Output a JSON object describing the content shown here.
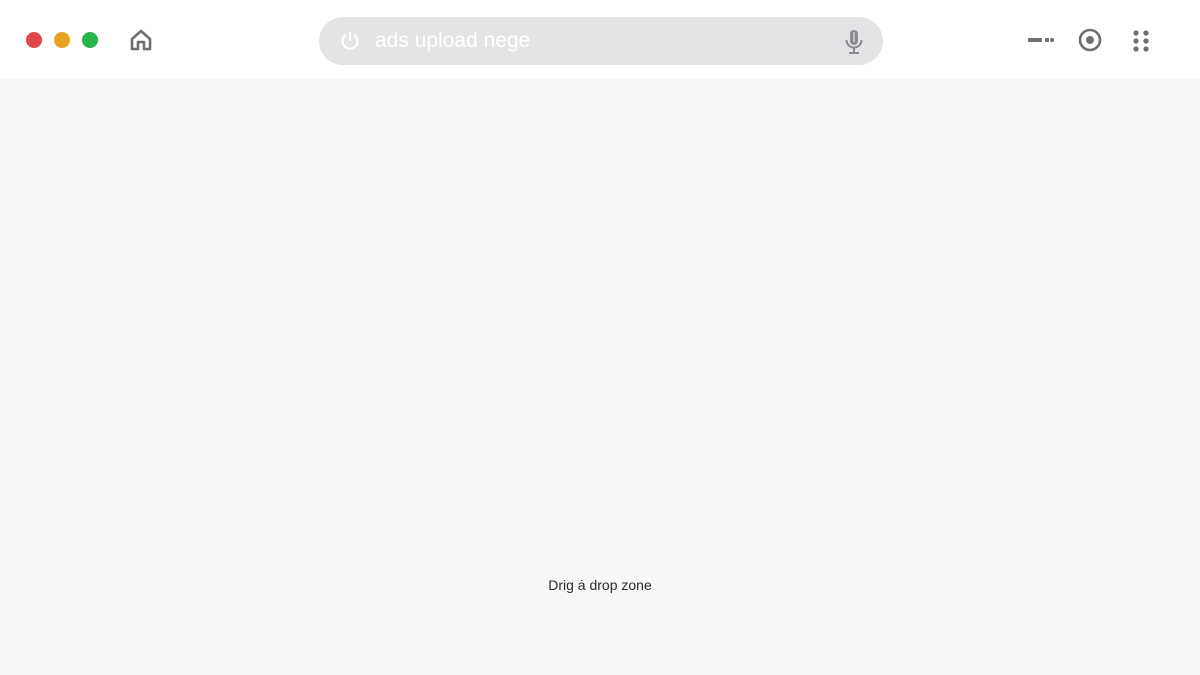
{
  "window": {
    "traffic_lights": [
      {
        "name": "close",
        "color": "#e0454a"
      },
      {
        "name": "minimize",
        "color": "#e8a323"
      },
      {
        "name": "maximize",
        "color": "#27b24a"
      }
    ]
  },
  "toolbar": {
    "home_icon": "home-icon",
    "search": {
      "value": "ads upload nege",
      "leading_icon": "power-icon",
      "trailing_icon": "mic-icon"
    },
    "right_icons": [
      "key-icon",
      "record-icon",
      "apps-grid-icon"
    ]
  },
  "main": {
    "drop_zone_label": "Drig ȧ drop zone"
  },
  "colors": {
    "toolbar_bg": "#ffffff",
    "content_bg": "#f7f7f6",
    "search_bg": "#e4e4e6",
    "icon_gray": "#6f6f73"
  }
}
